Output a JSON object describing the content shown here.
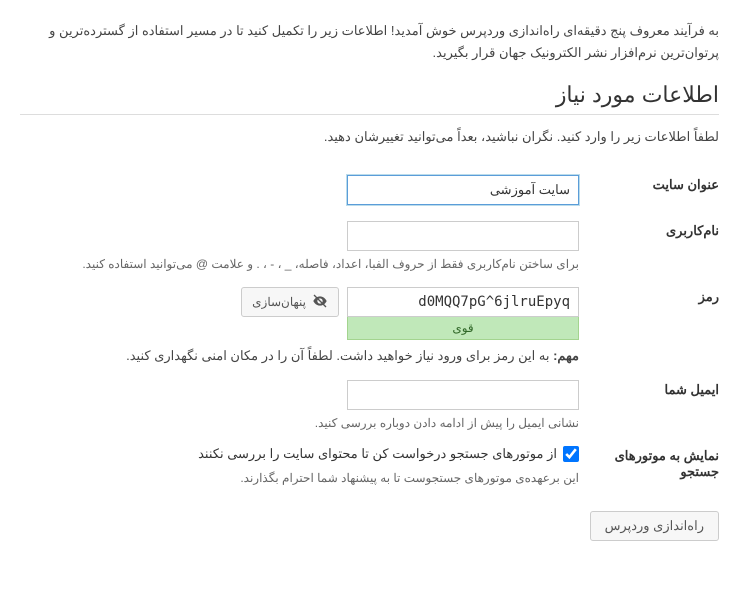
{
  "intro": "به فرآیند معروف پنج دقیقه‌ای راه‌اندازی وردپرس خوش آمدید! اطلاعات زیر را تکمیل کنید تا در مسیر استفاده از گسترده‌ترین و پرتوان‌ترین نرم‌افزار نشر الکترونیک جهان قرار بگیرید.",
  "section_title": "اطلاعات مورد نیاز",
  "subintro": "لطفاً اطلاعات زیر را وارد کنید. نگران نباشید، بعداً می‌توانید تغییرشان دهید.",
  "fields": {
    "site_title": {
      "label": "عنوان سایت",
      "value": "سایت آموزشی"
    },
    "username": {
      "label": "نام‌کاربری",
      "value": "",
      "hint": "برای ساختن نام‌کاربری فقط از حروف الفبا، اعداد، فاصله، _ ، - ، . و علامت @ می‌توانید استفاده کنید."
    },
    "password": {
      "label": "رمز",
      "value": "d0MQQ7pG^6jlruEpyq",
      "hide_button": "پنهان‌سازی",
      "strength": "قوی",
      "important_label": "مهم:",
      "important_text": " به این رمز برای ورود نیاز خواهید داشت. لطفاً آن را در مکان امنی نگهداری کنید."
    },
    "email": {
      "label": "ایمیل شما",
      "value": "",
      "hint": "نشانی ایمیل را پیش از ادامه دادن دوباره بررسی کنید."
    },
    "search_engines": {
      "label": "نمایش به موتورهای جستجو",
      "checkbox_label": "از موتورهای جستجو درخواست کن تا محتوای سایت را بررسی نکنند",
      "checked": true,
      "hint": "این برعهده‌ی موتورهای جستجوست تا به پیشنهاد شما احترام بگذارند."
    }
  },
  "submit": {
    "label": "راه‌اندازی وردپرس"
  }
}
